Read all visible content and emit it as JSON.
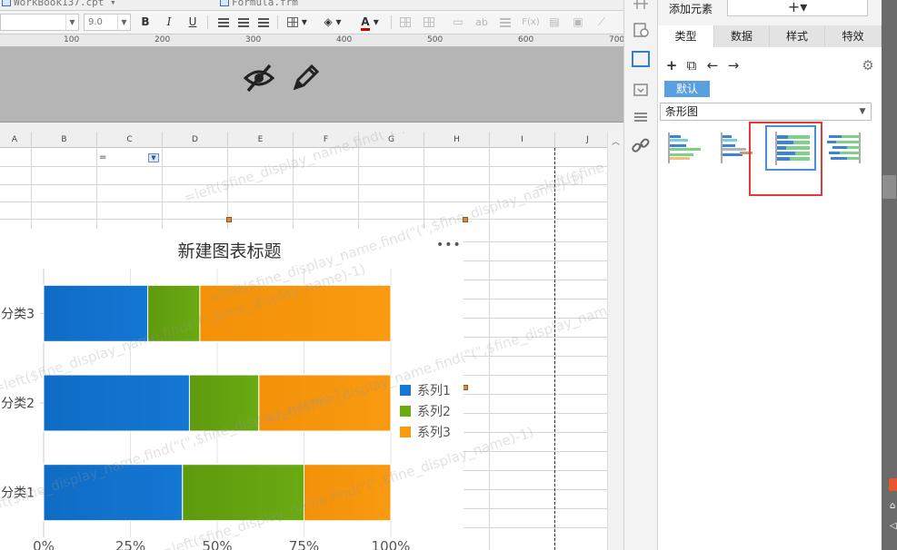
{
  "doc_tabs": [
    {
      "label": "WorkBook137.cpt"
    },
    {
      "label": "Formula.frm"
    }
  ],
  "toolbar": {
    "font_size": "9.0",
    "bold": "B",
    "italic": "I",
    "underline": "U",
    "font_color": "A",
    "ab": "ab",
    "fx": "F(x)"
  },
  "ruler": {
    "ticks": [
      "100",
      "200",
      "300",
      "400",
      "500",
      "600",
      "700"
    ]
  },
  "sheet": {
    "columns": [
      "A",
      "B",
      "C",
      "D",
      "E",
      "F",
      "G",
      "H",
      "I",
      "J"
    ],
    "cell_c1": "=",
    "watermark": "=left($fine_display_name,find(\"(\",$fine_display_name)-1)"
  },
  "chart": {
    "more": "•••"
  },
  "chart_data": {
    "type": "bar",
    "title": "新建图表标题",
    "orientation": "horizontal",
    "stacking": "percent",
    "categories": [
      "分类3",
      "分类2",
      "分类1"
    ],
    "series": [
      {
        "name": "系列1",
        "color": "#1477d4",
        "values": [
          30,
          42,
          40
        ]
      },
      {
        "name": "系列2",
        "color": "#6aaa12",
        "values": [
          15,
          20,
          35
        ]
      },
      {
        "name": "系列3",
        "color": "#f99a10",
        "values": [
          55,
          38,
          25
        ]
      }
    ],
    "xlim": [
      0,
      100
    ],
    "x_ticks": [
      "0%",
      "25%",
      "50%",
      "75%",
      "100%"
    ],
    "grid": true,
    "legend_position": "right"
  },
  "panel": {
    "add_label": "添加元素",
    "add_button": "+▾",
    "tabs": [
      {
        "label": "类型"
      },
      {
        "label": "数据"
      },
      {
        "label": "样式"
      },
      {
        "label": "特效"
      }
    ],
    "default_label": "默认",
    "chart_type": "条形图",
    "selected_thumb_index": 2
  },
  "icons": {
    "hide": "eye-slash-icon",
    "edit": "pencil-icon",
    "settings": "gear-icon"
  }
}
